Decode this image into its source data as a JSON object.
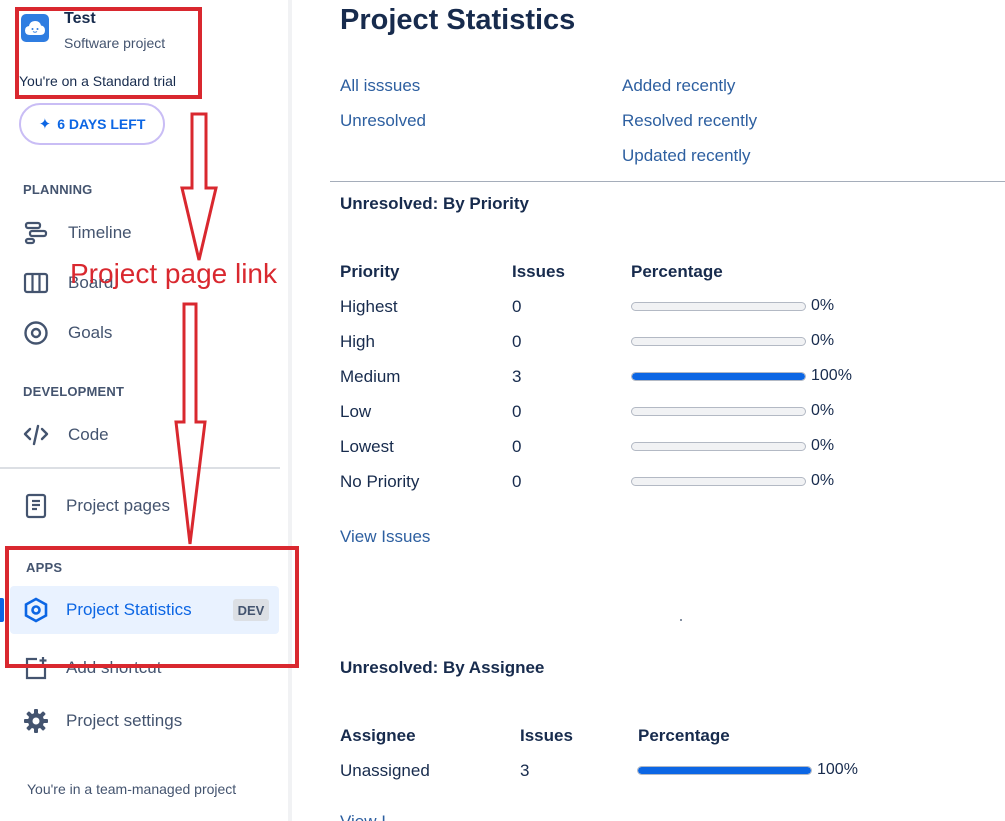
{
  "project": {
    "name": "Test",
    "type": "Software project",
    "trial_text": "You're on a Standard trial",
    "days_left": "6 DAYS LEFT"
  },
  "sidebar": {
    "planning_label": "PLANNING",
    "planning_items": [
      {
        "label": "Timeline",
        "icon": "timeline-icon"
      },
      {
        "label": "Board",
        "icon": "board-icon"
      },
      {
        "label": "Goals",
        "icon": "goals-icon"
      }
    ],
    "development_label": "DEVELOPMENT",
    "development_items": [
      {
        "label": "Code",
        "icon": "code-icon"
      }
    ],
    "project_pages": "Project pages",
    "apps_label": "APPS",
    "apps_items": [
      {
        "label": "Project Statistics",
        "badge": "DEV",
        "icon": "hexagon-app-icon"
      }
    ],
    "add_shortcut": "Add shortcut",
    "project_settings": "Project settings",
    "footer": "You're in a team-managed project",
    "footer_tail": "..."
  },
  "annotation": {
    "text": "Project page link",
    "color": "#d9282f"
  },
  "main": {
    "title": "Project Statistics",
    "links_left": [
      "All isssues",
      "Unresolved"
    ],
    "links_right": [
      "Added recently",
      "Resolved recently",
      "Updated recently"
    ],
    "priority_section": {
      "title": "Unresolved: By Priority",
      "headers": [
        "Priority",
        "Issues",
        "Percentage"
      ],
      "rows": [
        {
          "name": "Highest",
          "issues": "0",
          "percent": 0,
          "percent_label": "0%"
        },
        {
          "name": "High",
          "issues": "0",
          "percent": 0,
          "percent_label": "0%"
        },
        {
          "name": "Medium",
          "issues": "3",
          "percent": 100,
          "percent_label": "100%"
        },
        {
          "name": "Low",
          "issues": "0",
          "percent": 0,
          "percent_label": "0%"
        },
        {
          "name": "Lowest",
          "issues": "0",
          "percent": 0,
          "percent_label": "0%"
        },
        {
          "name": "No Priority",
          "issues": "0",
          "percent": 0,
          "percent_label": "0%"
        }
      ],
      "view_link": "View Issues"
    },
    "assignee_section": {
      "title": "Unresolved: By Assignee",
      "headers": [
        "Assignee",
        "Issues",
        "Percentage"
      ],
      "rows": [
        {
          "name": "Unassigned",
          "issues": "3",
          "percent": 100,
          "percent_label": "100%"
        }
      ],
      "view_link_partial": "View I..."
    }
  },
  "colors": {
    "accent": "#0c66e4",
    "link": "#2d5fa0",
    "text": "#172b4d",
    "annotation_red": "#d9282f"
  }
}
